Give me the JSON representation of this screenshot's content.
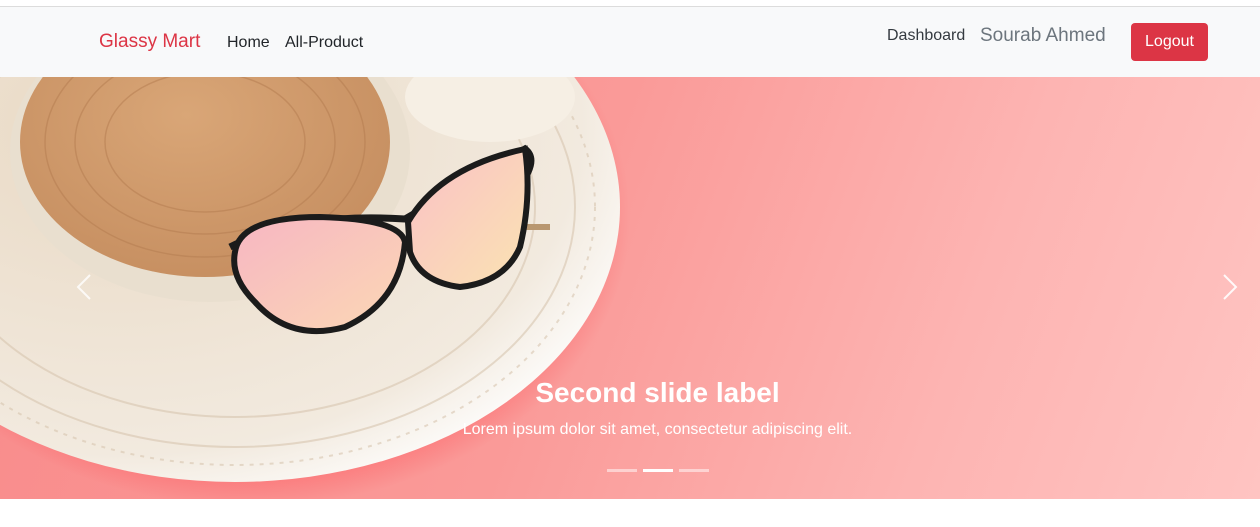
{
  "navbar": {
    "brand": "Glassy Mart",
    "links": [
      {
        "label": "Home"
      },
      {
        "label": "All-Product"
      }
    ],
    "dashboard_label": "Dashboard",
    "user_name": "Sourab Ahmed",
    "logout_label": "Logout"
  },
  "carousel": {
    "caption_title": "Second slide label",
    "caption_text": "Lorem ipsum dolor sit amet, consectetur adipiscing elit.",
    "active_index": 1,
    "slide_count": 3,
    "prev_icon": "chevron-left-icon",
    "next_icon": "chevron-right-icon"
  },
  "colors": {
    "brand": "#dc3545",
    "navbar_bg": "#f8f9fa",
    "logout_bg": "#dc3545",
    "slide_bg": "#f98a8a"
  }
}
